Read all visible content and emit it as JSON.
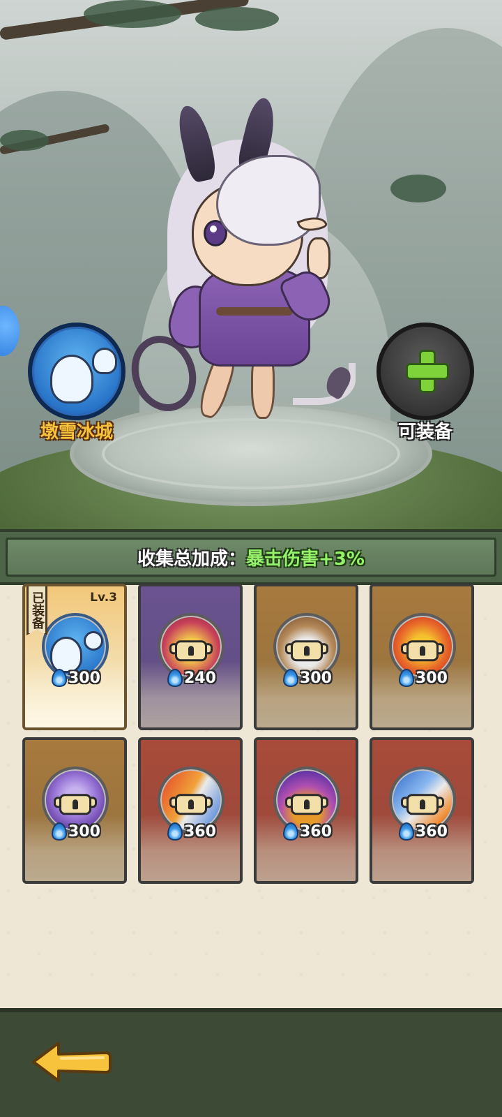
{
  "pet_slot": {
    "name": "墩雪冰城",
    "icon": "ice-pet-portrait"
  },
  "equip_slot": {
    "label": "可装备",
    "icon": "plus-icon"
  },
  "bonus": {
    "label": "收集总加成：",
    "value": "暴击伤害+3%"
  },
  "cards": [
    {
      "cost": "300",
      "state": "equipped",
      "tag": "已装备",
      "level": "Lv.3",
      "theme": "gold-active",
      "portrait": "ice-ghost"
    },
    {
      "cost": "240",
      "state": "locked",
      "theme": "purple",
      "portrait_colors": [
        "#c7415a",
        "#f2c24b"
      ]
    },
    {
      "cost": "300",
      "state": "locked",
      "theme": "gold",
      "portrait_colors": [
        "#6b3c1e",
        "#e9e9e9"
      ]
    },
    {
      "cost": "300",
      "state": "locked",
      "theme": "gold",
      "portrait_colors": [
        "#d2371f",
        "#f5c22e"
      ]
    },
    {
      "cost": "300",
      "state": "locked",
      "theme": "gold",
      "portrait_colors": [
        "#5a3196",
        "#9a78d8"
      ]
    },
    {
      "cost": "360",
      "state": "locked",
      "theme": "red",
      "portrait_colors": [
        "#e23f28",
        "#2e6fd6"
      ]
    },
    {
      "cost": "360",
      "state": "locked",
      "theme": "red",
      "portrait_colors": [
        "#6b37a8",
        "#e79a2a"
      ]
    },
    {
      "cost": "360",
      "state": "locked",
      "theme": "red",
      "portrait_colors": [
        "#2c65c9",
        "#f0903a"
      ]
    }
  ],
  "colors": {
    "bonus_value": "#95f26a",
    "pet_name": "#f7c23c",
    "back_arrow": "#f7c33c"
  }
}
